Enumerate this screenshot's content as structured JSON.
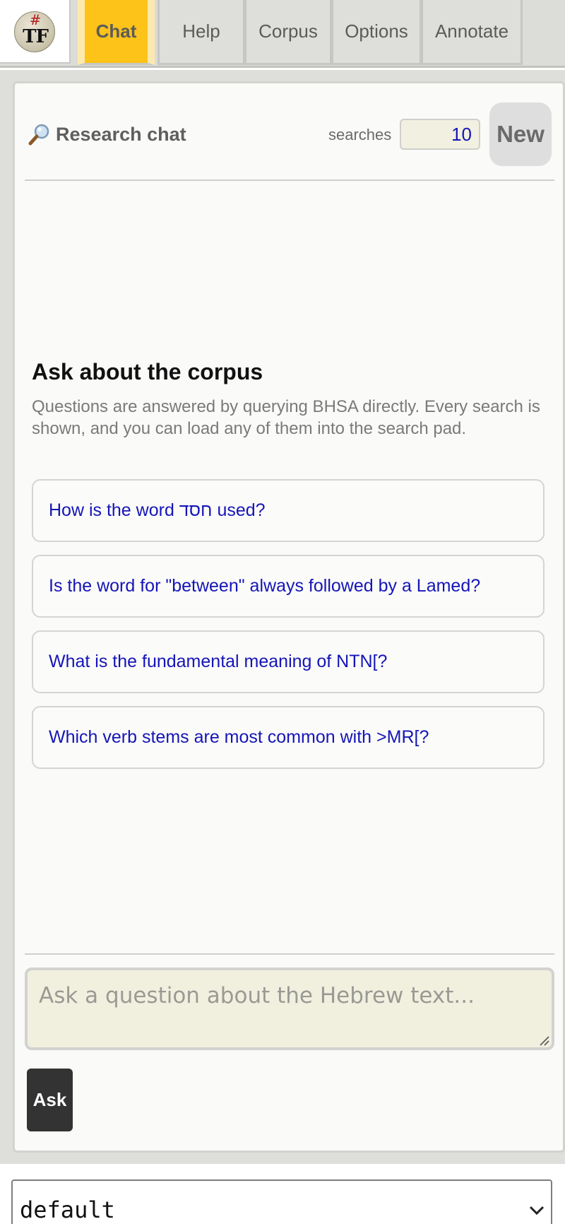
{
  "logo": {
    "hash": "#",
    "letters": "TF"
  },
  "tabs": [
    {
      "label": "Chat",
      "active": true
    },
    {
      "label": "Help",
      "active": false
    },
    {
      "label": "Corpus",
      "active": false
    },
    {
      "label": "Options",
      "active": false
    },
    {
      "label": "Annotate",
      "active": false
    }
  ],
  "chat": {
    "title": "Research chat",
    "title_icon": "magnifier-icon",
    "searches_label": "searches",
    "searches_value": "10",
    "new_label": "New"
  },
  "intro": {
    "heading": "Ask about the corpus",
    "description": "Questions are answered by querying BHSA directly. Every search is shown, and you can load any of them into the search pad."
  },
  "suggestions": [
    "How is the word חסד used?",
    "Is the word for \"between\" always followed by a Lamed?",
    "What is the fundamental meaning of NTN[?",
    "Which verb stems are most common with >MR[?"
  ],
  "composer": {
    "placeholder": "Ask a question about the Hebrew text...",
    "ask_label": "Ask"
  },
  "profile_select": {
    "value": "default"
  },
  "colors": {
    "active_tab": "#fdc318",
    "link_text": "#1515b8",
    "ask_button": "#333333",
    "input_bg": "#f1f0df"
  }
}
